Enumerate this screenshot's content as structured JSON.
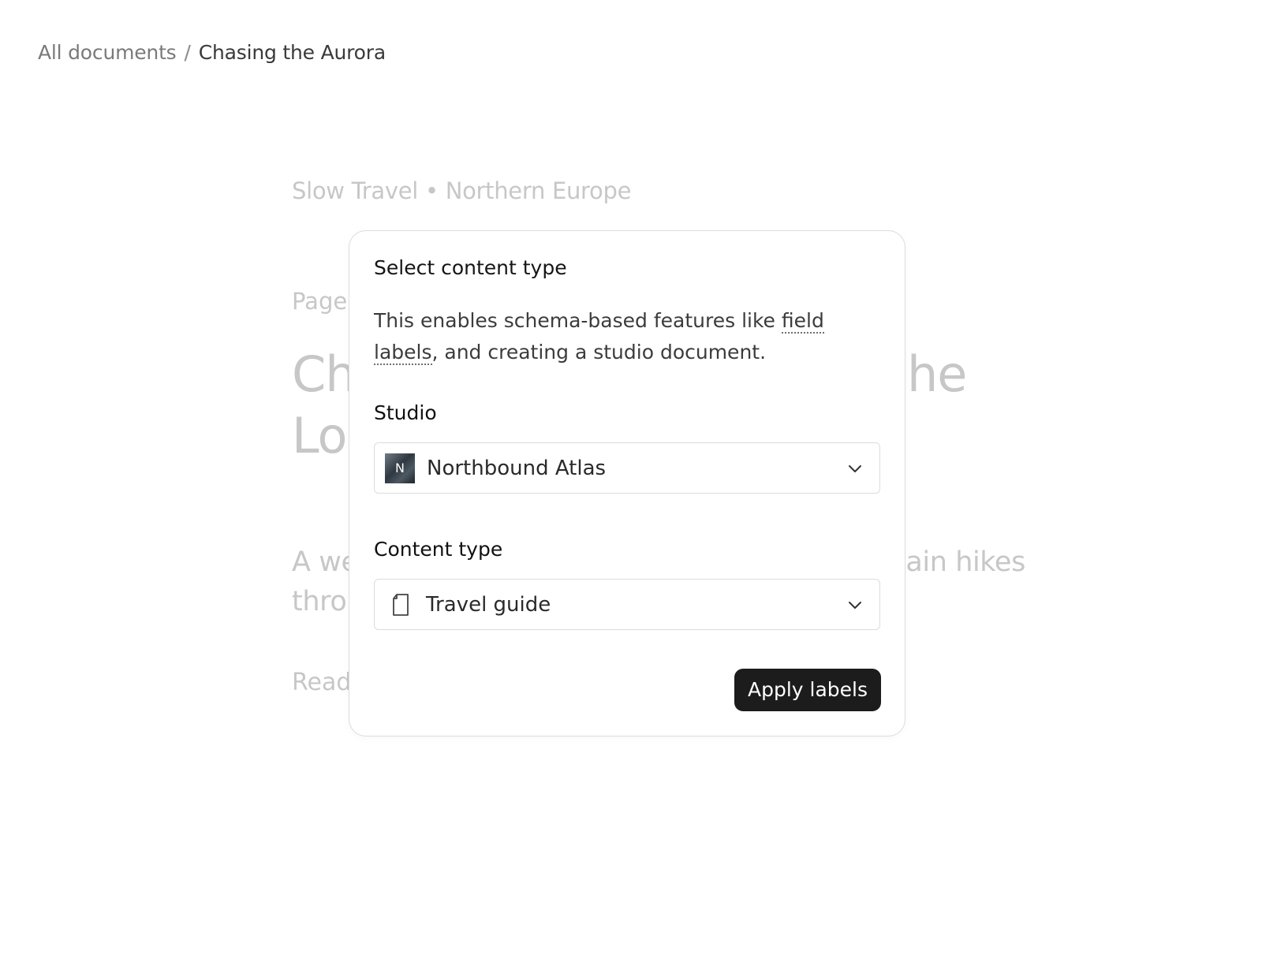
{
  "breadcrumb": {
    "root": "All documents",
    "separator": "/",
    "current": "Chasing the Aurora"
  },
  "background_doc": {
    "kicker": "Slow Travel • Northern Europe",
    "page_label_visible": "Page",
    "headline_line1_start": "Ch",
    "headline_line1_end": "he",
    "headline_line2_start": "Lo",
    "dek_line1_start": "A we",
    "dek_line1_end": "tain hikes",
    "dek_line2_start": "thro",
    "read_visible": "Read"
  },
  "dialog": {
    "title": "Select content type",
    "description_before": "This enables schema-based features like ",
    "description_link": "field labels",
    "description_after": ", and creating a studio document.",
    "studio": {
      "label": "Studio",
      "selected": "Northbound Atlas",
      "avatar_letter": "N"
    },
    "content_type": {
      "label": "Content type",
      "selected": "Travel guide"
    },
    "apply_label": "Apply labels"
  },
  "icons": {
    "chevron": "chevron-down-icon",
    "content_type": "document-icon"
  }
}
